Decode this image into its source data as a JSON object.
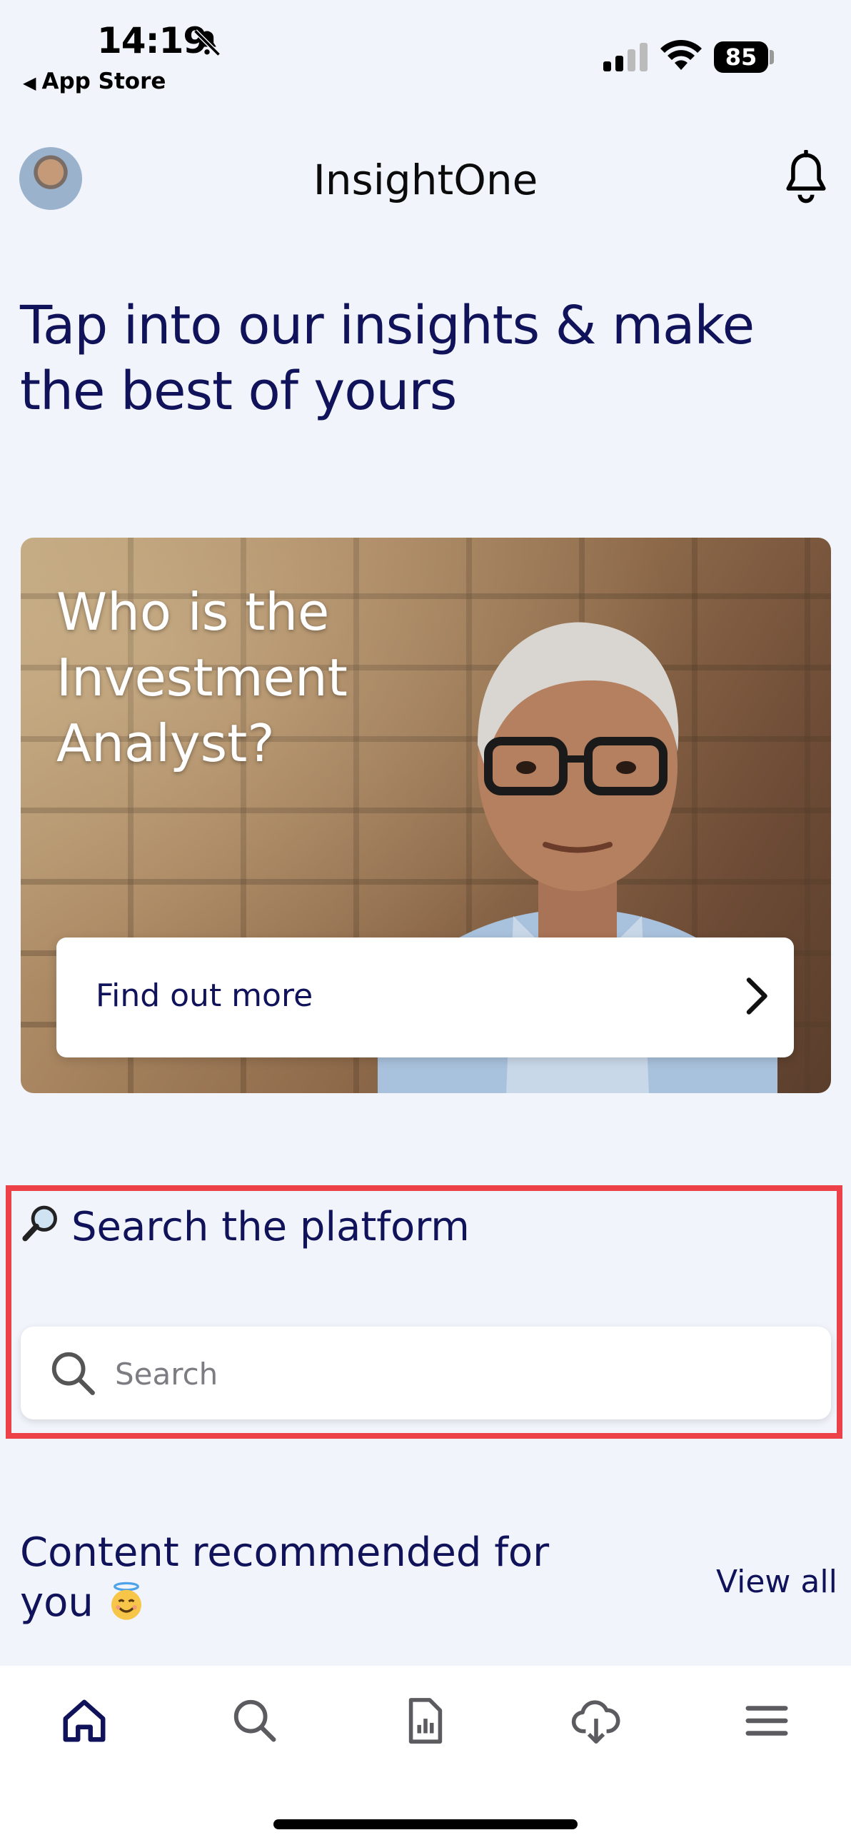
{
  "status_bar": {
    "time": "14:19",
    "back_label": "App Store",
    "battery": "85"
  },
  "header": {
    "title": "InsightOne",
    "avatar_icon": "avatar",
    "notification_icon": "bell-icon"
  },
  "hero": {
    "heading": "Tap into our insights & make the best of yours"
  },
  "feature_card": {
    "title": "Who is the Investment Analyst?",
    "cta_label": "Find out more"
  },
  "search": {
    "heading": "Search the platform",
    "placeholder": "Search",
    "highlight_color": "#ec4148"
  },
  "recommended": {
    "heading": "Content recommended for you",
    "view_all": "View all"
  },
  "tab_bar": {
    "items": [
      {
        "icon": "home-icon",
        "active": true
      },
      {
        "icon": "search-icon",
        "active": false
      },
      {
        "icon": "report-icon",
        "active": false
      },
      {
        "icon": "download-icon",
        "active": false
      },
      {
        "icon": "menu-icon",
        "active": false
      }
    ]
  },
  "colors": {
    "primary": "#10125a",
    "background": "#f1f4fb",
    "accent_highlight": "#ec4148"
  }
}
